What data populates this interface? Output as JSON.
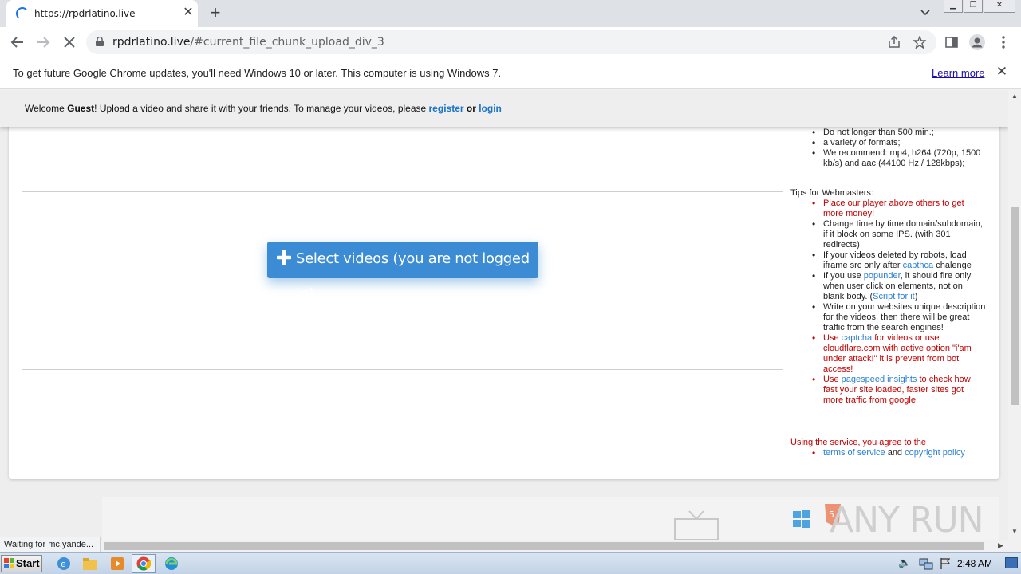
{
  "browser": {
    "tab_title": "https://rpdrlatino.live",
    "url_domain": "rpdrlatino.live",
    "url_path": "/#current_file_chunk_upload_div_3"
  },
  "infobar": {
    "message": "To get future Google Chrome updates, you'll need Windows 10 or later. This computer is using Windows 7.",
    "learn_more": "Learn more"
  },
  "welcome": {
    "prefix": "Welcome ",
    "user": "Guest",
    "middle": "! Upload a video and share it with your friends. To manage your videos, please ",
    "register": "register",
    "or": " or ",
    "login": "login"
  },
  "upload": {
    "button_label": "Select videos (you are not logged in)"
  },
  "requirements": [
    "Do not longer than 500 min.;",
    "a variety of formats;",
    "We recommend: mp4, h264 (720p, 1500 kb/s) and aac (44100 Hz / 128kbps);"
  ],
  "tips": {
    "heading": "Tips for Webmasters:",
    "item1": "Place our player above others to get more money!",
    "item2": "Change time by time domain/subdomain, if it block on some IPS. (with 301 redirects)",
    "item3_a": "If your videos deleted by robots, load iframe src only after ",
    "item3_link": "capthca",
    "item3_b": " chalenge",
    "item4_a": "If you use ",
    "item4_link": "popunder",
    "item4_b": ", it should fire only when user click on elements, not on blank body. (",
    "item4_link2": "Script for it",
    "item4_c": ")",
    "item5": "Write on your websites unique description for the videos, then there will be great traffic from the search engines!",
    "item6_a": "Use ",
    "item6_link": "captcha",
    "item6_b": " for videos or use cloudflare.com with active option \"i'am under attack!\" it is prevent from bot access!",
    "item7_a": "Use ",
    "item7_link": "pagespeed insights",
    "item7_b": " to check how fast your site loaded, faster sites got more traffic from google"
  },
  "agreement": {
    "text": "Using the service, you agree to the",
    "terms": "terms of service",
    "and": " and ",
    "policy": "copyright policy"
  },
  "status_bar": "Waiting for mc.yande...",
  "taskbar": {
    "start": "Start",
    "clock": "2:48 AM"
  },
  "watermark": "ANY RUN",
  "colors": {
    "accent_button": "#3b8cd4",
    "tip_red": "#c40000",
    "link_blue": "#2a7fd2"
  }
}
